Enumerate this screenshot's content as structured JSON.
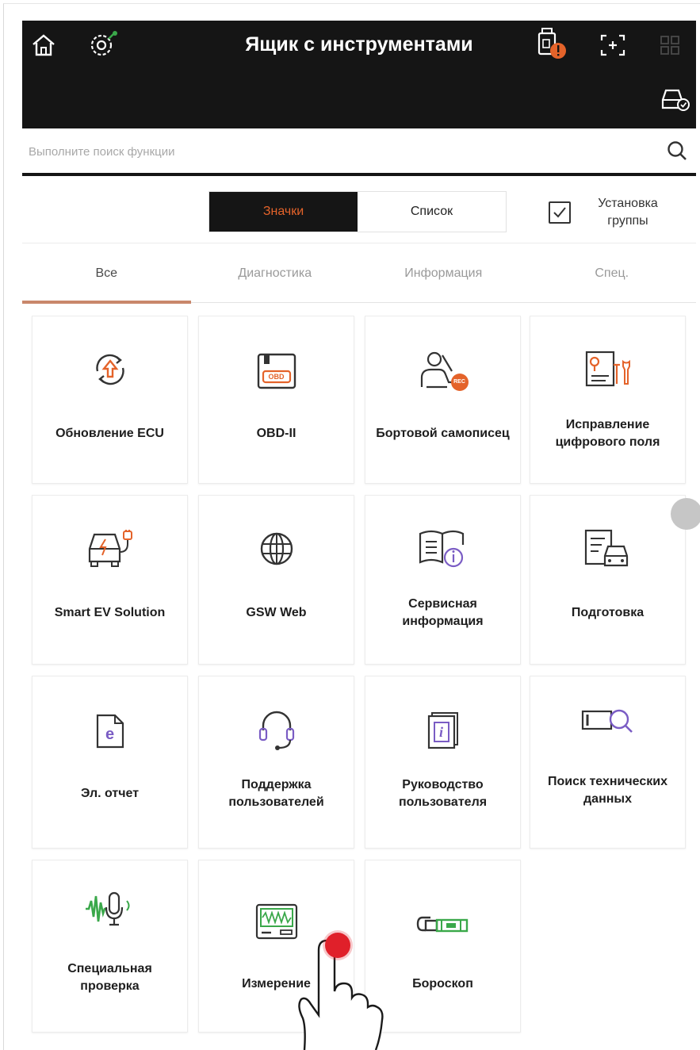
{
  "header": {
    "title": "Ящик с инструментами",
    "icons": [
      "home-icon",
      "vehicle-settings-icon",
      "vci-warning-icon",
      "screen-capture-icon",
      "grid-menu-icon",
      "vehicle-connection-icon"
    ]
  },
  "search": {
    "placeholder": "Выполните поиск функции",
    "icon": "search-icon"
  },
  "view_toggle": {
    "icons_label": "Значки",
    "list_label": "Список",
    "active": "icons"
  },
  "group_setting": {
    "label": "Установка группы",
    "checked": true
  },
  "tabs": [
    {
      "label": "Все",
      "active": true
    },
    {
      "label": "Диагностика",
      "active": false
    },
    {
      "label": "Информация",
      "active": false
    },
    {
      "label": "Спец.",
      "active": false
    }
  ],
  "tools": [
    {
      "label": "Обновление ECU",
      "icon": "ecu-update-icon"
    },
    {
      "label": "OBD-II",
      "icon": "obd-icon",
      "icon_text": "OBD"
    },
    {
      "label": "Бортовой самописец",
      "icon": "flight-recorder-icon",
      "icon_text": "REC"
    },
    {
      "label": "Исправление цифрового поля",
      "icon": "field-fix-icon"
    },
    {
      "label": "Smart EV Solution",
      "icon": "ev-car-icon"
    },
    {
      "label": "GSW Web",
      "icon": "globe-icon"
    },
    {
      "label": "Сервисная информация",
      "icon": "service-book-icon"
    },
    {
      "label": "Подготовка",
      "icon": "preparation-icon"
    },
    {
      "label": "Эл. отчет",
      "icon": "e-report-icon",
      "icon_text": "e"
    },
    {
      "label": "Поддержка пользователей",
      "icon": "headset-icon"
    },
    {
      "label": "Руководство пользователя",
      "icon": "user-manual-icon",
      "icon_text": "i"
    },
    {
      "label": "Поиск технических данных",
      "icon": "tech-data-search-icon"
    },
    {
      "label": "Специальная проверка",
      "icon": "sound-check-icon"
    },
    {
      "label": "Измерение",
      "icon": "oscilloscope-icon"
    },
    {
      "label": "Бороскоп",
      "icon": "borescope-icon"
    }
  ],
  "colors": {
    "header_bg": "#151515",
    "accent_orange": "#e4632a",
    "tab_underline": "#c9876b",
    "icon_purple": "#7a5cc4",
    "icon_green": "#3aa84a",
    "touch_indicator": "#e0202a"
  }
}
